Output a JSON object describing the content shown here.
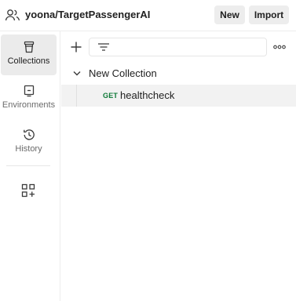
{
  "header": {
    "workspace_name": "yoona/TargetPassengerAI",
    "workspace_icon": "team-icon",
    "new_label": "New",
    "import_label": "Import"
  },
  "sidebar": {
    "items": [
      {
        "label": "Collections",
        "icon": "collections-icon",
        "active": true
      },
      {
        "label": "Environments",
        "icon": "environments-icon",
        "active": false
      },
      {
        "label": "History",
        "icon": "history-icon",
        "active": false
      }
    ],
    "extra_icon": "add-apps-icon"
  },
  "toolbar": {
    "add_icon": "plus-icon",
    "filter_icon": "filter-icon",
    "more_icon": "more-icon"
  },
  "tree": {
    "collection": {
      "name": "New Collection",
      "expanded": true
    },
    "requests": [
      {
        "method": "GET",
        "name": "healthcheck"
      }
    ]
  },
  "colors": {
    "get_method": "#0f7a38",
    "active_bg": "#ebebeb",
    "button_bg": "#ededed"
  }
}
